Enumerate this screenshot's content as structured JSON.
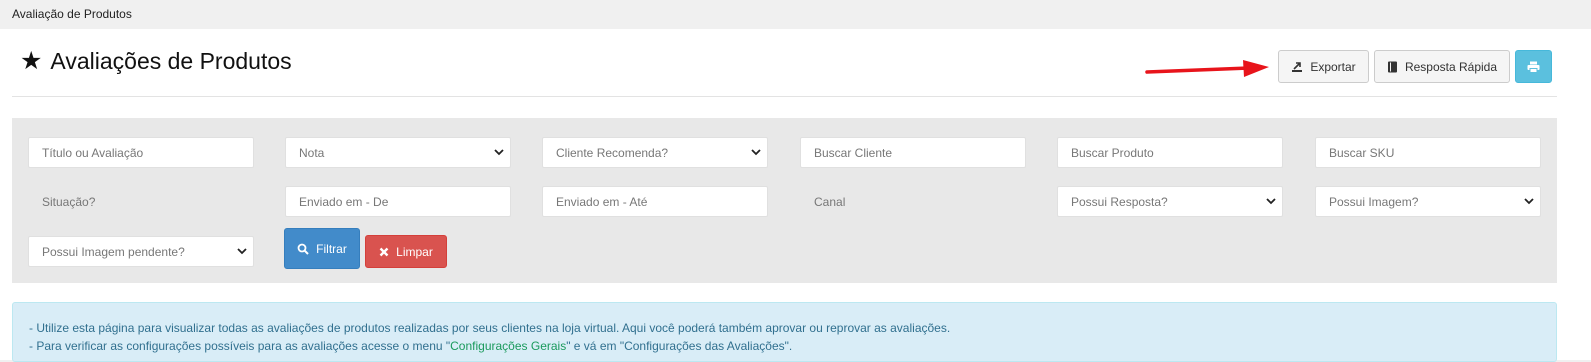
{
  "breadcrumb": "Avaliação de Produtos",
  "page_title": "Avaliações de Produtos",
  "toolbar": {
    "export_label": "Exportar",
    "quick_reply_label": "Resposta Rápida"
  },
  "filters": {
    "title_or_review_placeholder": "Título ou Avaliação",
    "rating_selected": "Nota",
    "recommends_selected": "Cliente Recomenda?",
    "customer_placeholder": "Buscar Cliente",
    "product_placeholder": "Buscar Produto",
    "sku_placeholder": "Buscar SKU",
    "status_label": "Situação?",
    "sent_from_placeholder": "Enviado em - De",
    "sent_to_placeholder": "Enviado em - Até",
    "channel_label": "Canal",
    "has_reply_selected": "Possui Resposta?",
    "has_image_selected": "Possui Imagem?",
    "pending_image_selected": "Possui Imagem pendente?",
    "filter_button": "Filtrar",
    "clear_button": "Limpar"
  },
  "info": {
    "line1": "- Utilize esta página para visualizar todas as avaliações de produtos realizadas por seus clientes na loja virtual. Aqui você poderá também aprovar ou reprovar as avaliações.",
    "line2_prefix": "- Para verificar as configurações possíveis para as avaliações acesse o menu \"",
    "line2_link": "Configurações Gerais",
    "line2_suffix": "\" e vá em \"Configurações das Avaliações\"."
  },
  "colors": {
    "filter_button": "#428bca",
    "clear_button": "#d9534f",
    "print_button": "#5bc0de",
    "info_background": "#d9edf7",
    "annotation_arrow": "#e8141b"
  }
}
